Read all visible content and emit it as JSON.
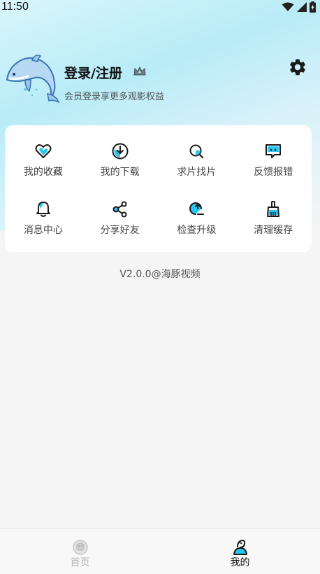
{
  "status_bar": {
    "time": "11:50",
    "icons": [
      "wifi-icon",
      "signal-icon",
      "battery-charging-icon"
    ]
  },
  "profile": {
    "avatar_icon": "dolphin-icon",
    "login_title": "登录/注册",
    "crown_icon": "crown-icon",
    "subtitle": "会员登录享更多观影权益",
    "settings_icon": "gear-icon"
  },
  "menu": {
    "items": [
      {
        "label": "我的收藏",
        "icon": "heart-icon"
      },
      {
        "label": "我的下载",
        "icon": "download-icon"
      },
      {
        "label": "求片找片",
        "icon": "search-icon"
      },
      {
        "label": "反馈报错",
        "icon": "feedback-icon"
      },
      {
        "label": "消息中心",
        "icon": "bell-icon"
      },
      {
        "label": "分享好友",
        "icon": "share-icon"
      },
      {
        "label": "检查升级",
        "icon": "upgrade-icon"
      },
      {
        "label": "清理缓存",
        "icon": "broom-icon"
      }
    ]
  },
  "version": "V2.0.0@海豚视频",
  "tabbar": {
    "tabs": [
      {
        "label": "首页",
        "icon": "home-icon",
        "active": false
      },
      {
        "label": "我的",
        "icon": "profile-icon",
        "active": true
      }
    ]
  },
  "colors": {
    "accent": "#29c6ef",
    "icon_stroke": "#1a1a1a",
    "background": "#f5f5f5"
  }
}
